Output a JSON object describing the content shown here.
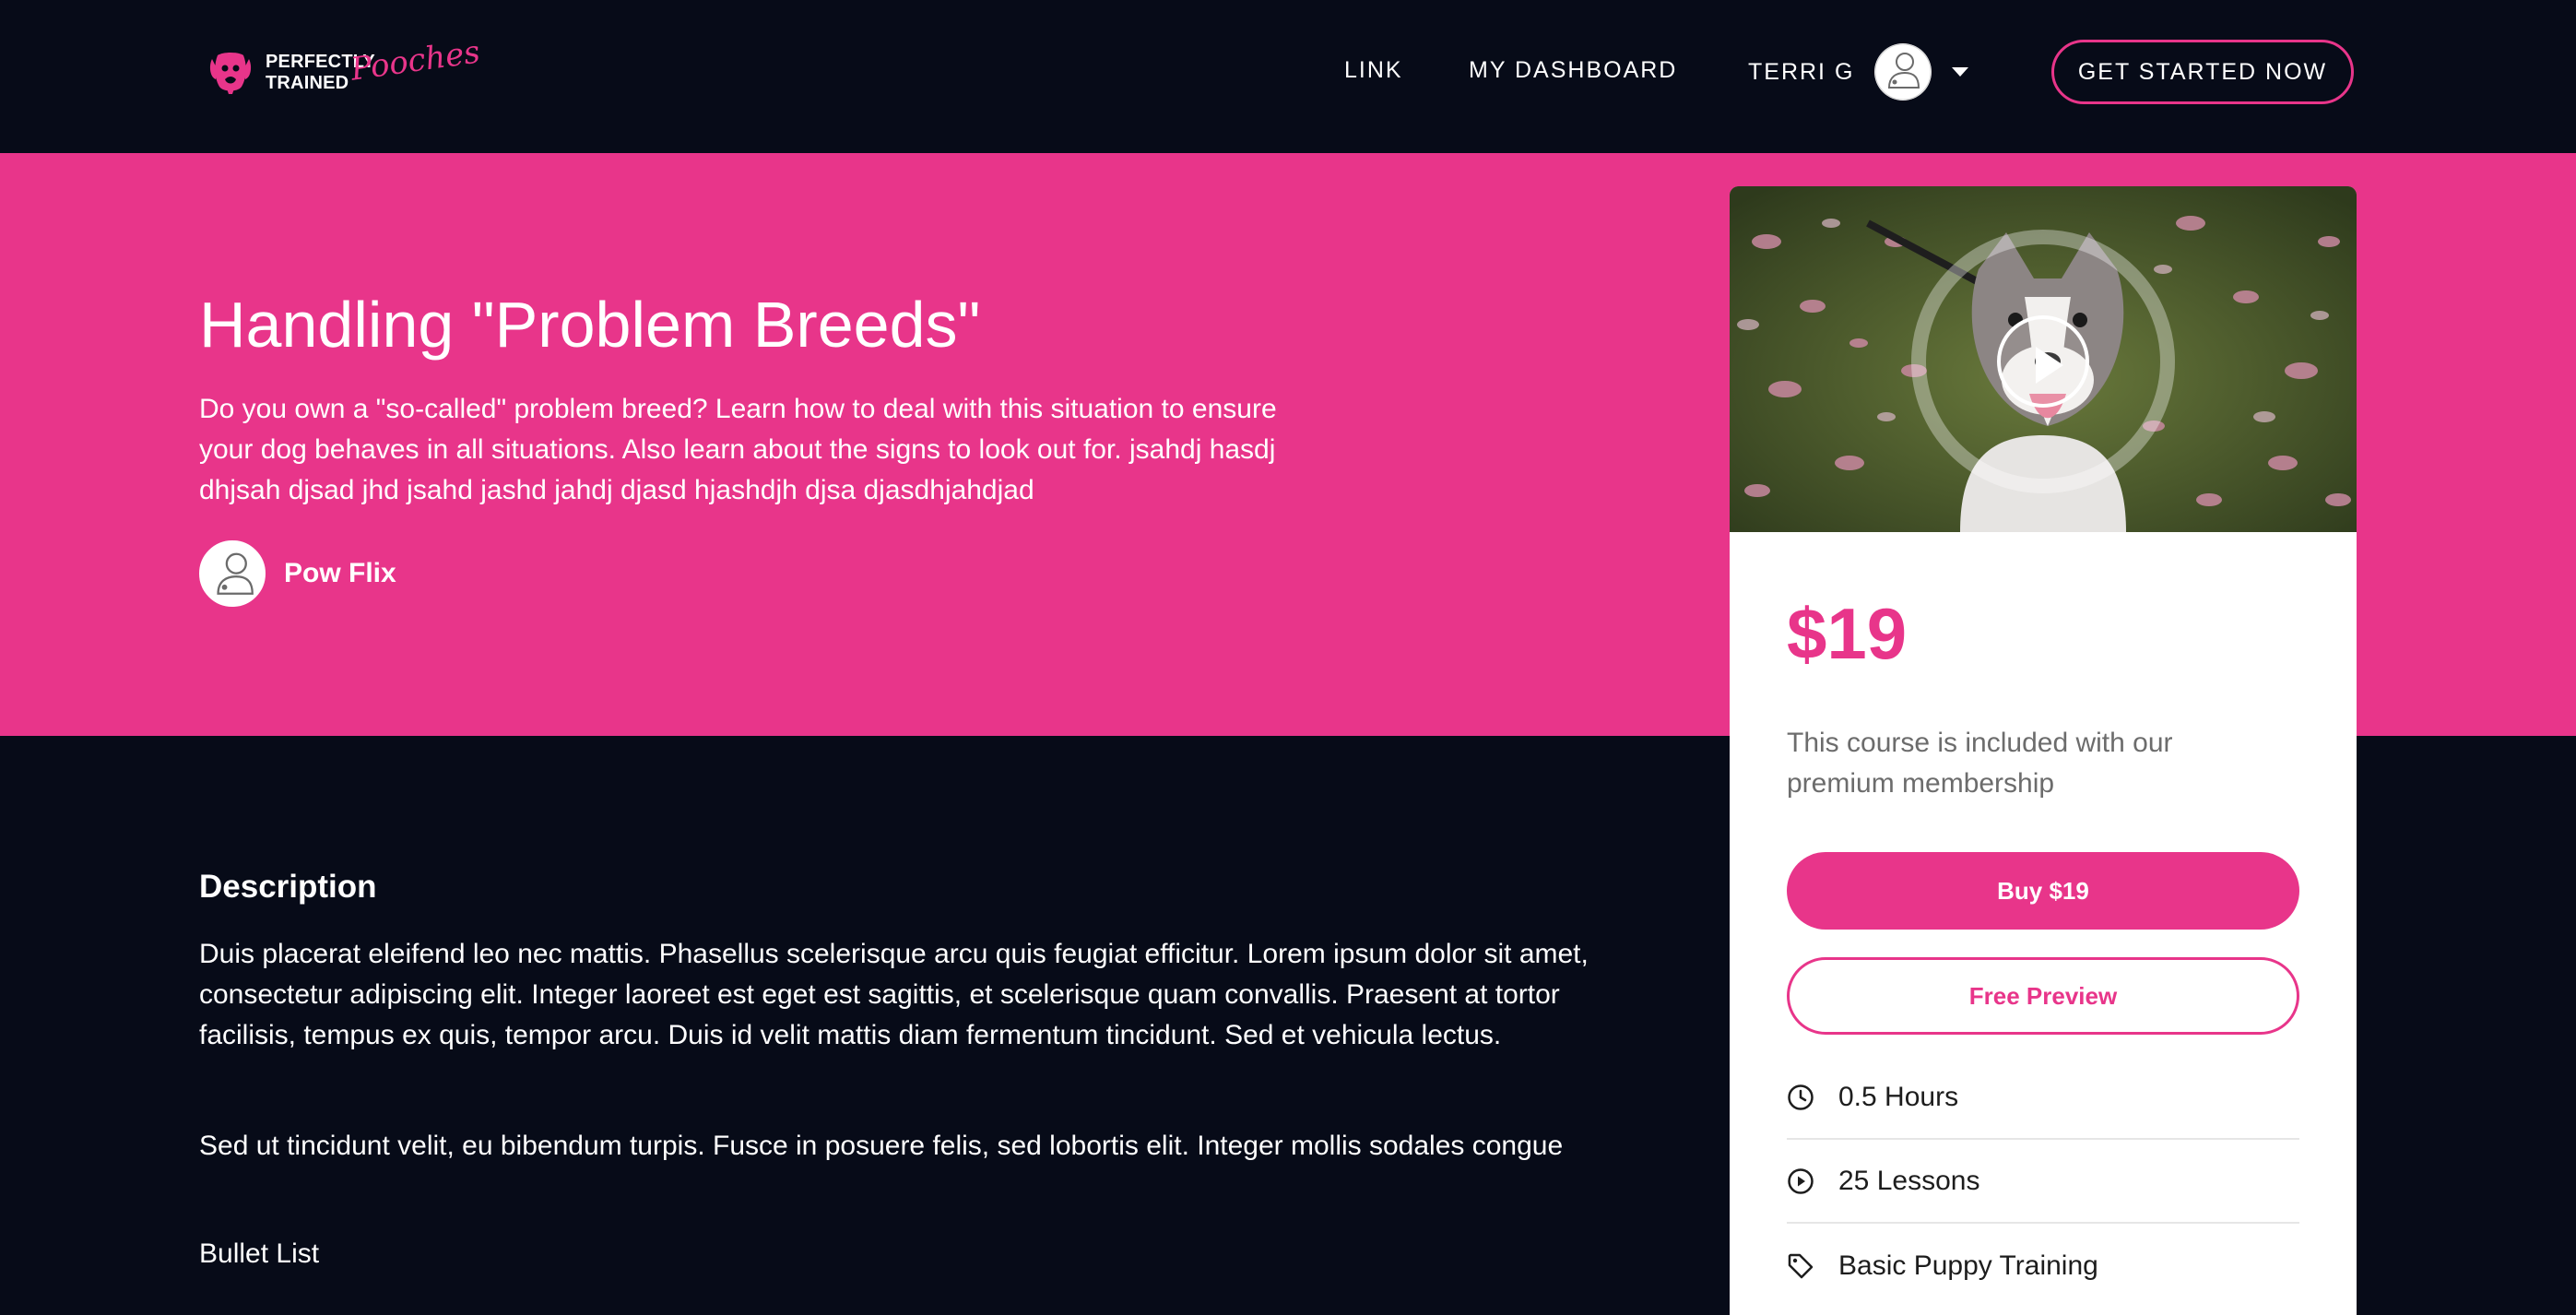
{
  "header": {
    "logo": {
      "line1": "PERFECTLY",
      "line2": "TRAINED",
      "script": "Pooches"
    },
    "nav": {
      "link": "LINK",
      "dashboard": "MY DASHBOARD"
    },
    "user": {
      "name": "TERRI G"
    },
    "cta_label": "GET STARTED NOW"
  },
  "hero": {
    "title": "Handling \"Problem Breeds\"",
    "description": "Do you own a \"so-called\" problem breed? Learn how to deal with this situation to ensure your dog behaves in all situations. Also learn about the signs to look out for. jsahdj hasdj dhjsah djsad jhd jsahd jashd jahdj djasd hjashdjh djsa djasdhjahdjad",
    "author": "Pow Flix"
  },
  "main": {
    "description_heading": "Description",
    "paragraphs": [
      "Duis placerat eleifend leo nec mattis. Phasellus scelerisque arcu quis feugiat efficitur. Lorem ipsum dolor sit amet, consectetur adipiscing elit. Integer laoreet est eget est sagittis, et scelerisque quam convallis. Praesent at tortor facilisis, tempus ex quis, tempor arcu. Duis id velit mattis diam fermentum tincidunt. Sed et vehicula lectus.",
      "Sed ut tincidunt velit, eu bibendum turpis. Fusce in posuere felis, sed lobortis elit. Integer mollis sodales congue"
    ],
    "bullet_list_label": "Bullet List"
  },
  "card": {
    "price": "$19",
    "included_text": "This course is included with our premium membership",
    "buy_label": "Buy $19",
    "preview_label": "Free Preview",
    "meta": [
      {
        "icon": "clock-icon",
        "text": "0.5 Hours"
      },
      {
        "icon": "play-circle-icon",
        "text": "25 Lessons"
      },
      {
        "icon": "tag-icon",
        "text": "Basic Puppy Training"
      }
    ]
  },
  "colors": {
    "accent": "#e8358a",
    "background": "#070b18",
    "card": "#ffffff",
    "muted_text": "#6c6c6c"
  }
}
